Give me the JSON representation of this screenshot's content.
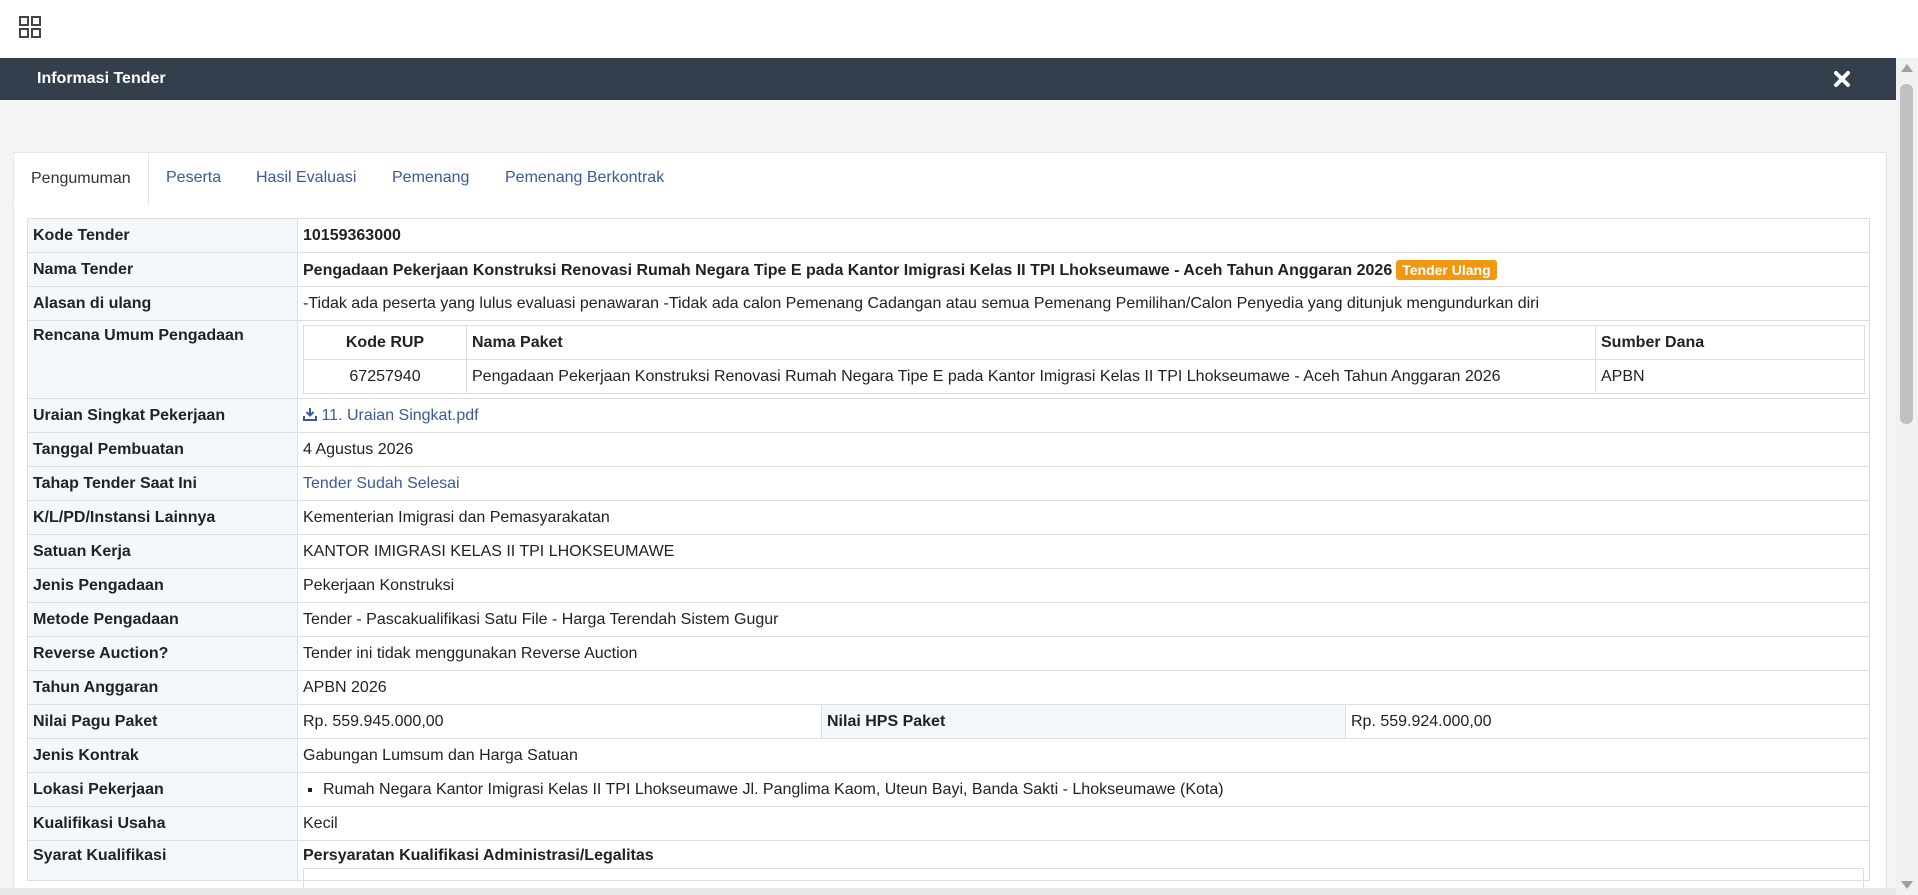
{
  "modal": {
    "title": "Informasi Tender"
  },
  "icons": {
    "apps": "grid-icon",
    "close": "close-icon",
    "download": "download-icon"
  },
  "colors": {
    "header_bg": "#343f4e",
    "badge": "#f0980f",
    "link": "#3a5a9c",
    "label_bg": "#f2f8fc"
  },
  "tabs": [
    {
      "label": "Pengumuman",
      "active": true
    },
    {
      "label": "Peserta"
    },
    {
      "label": "Hasil Evaluasi"
    },
    {
      "label": "Pemenang"
    },
    {
      "label": "Pemenang Berkontrak"
    }
  ],
  "rows": {
    "kode_tender": {
      "label": "Kode Tender",
      "value": "10159363000"
    },
    "nama_tender": {
      "label": "Nama Tender",
      "value": "Pengadaan Pekerjaan Konstruksi Renovasi Rumah Negara Tipe E pada Kantor Imigrasi Kelas II TPI Lhokseumawe - Aceh Tahun Anggaran 2026",
      "badge": "Tender Ulang"
    },
    "alasan": {
      "label": "Alasan di ulang",
      "value": "-Tidak ada peserta yang lulus evaluasi penawaran -Tidak ada calon Pemenang Cadangan atau semua Pemenang Pemilihan/Calon Penyedia yang ditunjuk mengundurkan diri"
    },
    "rup": {
      "label": "Rencana Umum Pengadaan",
      "headers": [
        "Kode RUP",
        "Nama Paket",
        "Sumber Dana"
      ],
      "kode": "67257940",
      "nama": "Pengadaan Pekerjaan Konstruksi Renovasi Rumah Negara Tipe E pada Kantor Imigrasi Kelas II TPI Lhokseumawe - Aceh Tahun Anggaran 2026",
      "sumber": "APBN"
    },
    "uraian": {
      "label": "Uraian Singkat Pekerjaan",
      "value": "11. Uraian Singkat.pdf"
    },
    "tanggal": {
      "label": "Tanggal Pembuatan",
      "value": "4 Agustus 2026"
    },
    "tahap": {
      "label": "Tahap Tender Saat Ini",
      "value": "Tender Sudah Selesai"
    },
    "klpd": {
      "label": "K/L/PD/Instansi Lainnya",
      "value": "Kementerian Imigrasi dan Pemasyarakatan"
    },
    "satuan": {
      "label": "Satuan Kerja",
      "value": "KANTOR IMIGRASI KELAS II TPI LHOKSEUMAWE"
    },
    "jenis_pengadaan": {
      "label": "Jenis Pengadaan",
      "value": "Pekerjaan Konstruksi"
    },
    "metode": {
      "label": "Metode Pengadaan",
      "value": "Tender - Pascakualifikasi Satu File - Harga Terendah Sistem Gugur"
    },
    "reverse": {
      "label": "Reverse Auction?",
      "value": "Tender ini tidak menggunakan Reverse Auction"
    },
    "tahun": {
      "label": "Tahun Anggaran",
      "value": "APBN 2026"
    },
    "pagu": {
      "label": "Nilai Pagu Paket",
      "value": "Rp. 559.945.000,00",
      "hps_label": "Nilai HPS Paket",
      "hps_value": "Rp. 559.924.000,00"
    },
    "jenis_kontrak": {
      "label": "Jenis Kontrak",
      "value": "Gabungan Lumsum dan Harga Satuan"
    },
    "lokasi": {
      "label": "Lokasi Pekerjaan",
      "value": "Rumah Negara Kantor Imigrasi Kelas II TPI Lhokseumawe Jl. Panglima Kaom, Uteun Bayi, Banda Sakti - Lhokseumawe (Kota)"
    },
    "kualifikasi": {
      "label": "Kualifikasi Usaha",
      "value": "Kecil"
    },
    "syarat": {
      "label": "Syarat Kualifikasi",
      "value": "Persyaratan Kualifikasi Administrasi/Legalitas"
    }
  }
}
